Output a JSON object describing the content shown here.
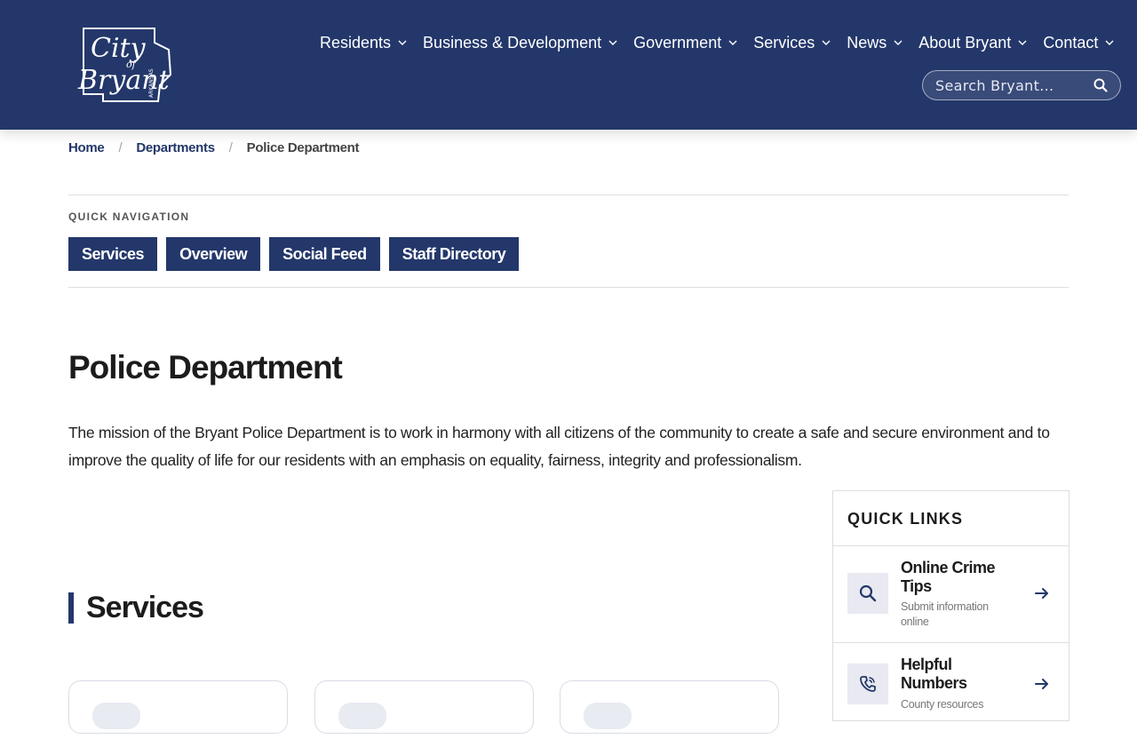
{
  "header": {
    "logo_text": "City of Bryant Arkansas",
    "nav": [
      {
        "label": "Residents"
      },
      {
        "label": "Business & Development"
      },
      {
        "label": "Government"
      },
      {
        "label": "Services"
      },
      {
        "label": "News"
      },
      {
        "label": "About Bryant"
      },
      {
        "label": "Contact"
      }
    ],
    "search_placeholder": "Search Bryant..."
  },
  "breadcrumb": {
    "items": [
      "Home",
      "Departments"
    ],
    "current": "Police Department",
    "separator": "/"
  },
  "quick_nav": {
    "label": "QUICK NAVIGATION",
    "buttons": [
      "Services",
      "Overview",
      "Social Feed",
      "Staff Directory"
    ]
  },
  "main": {
    "title": "Police Department",
    "mission": "The mission of the Bryant Police Department is to work in harmony with all citizens of the community to create a safe and secure environment and to improve the quality of life for our residents with an emphasis on equality, fairness, integrity and professionalism.",
    "services_heading": "Services"
  },
  "quick_links": {
    "title": "QUICK LINKS",
    "items": [
      {
        "name": "Online Crime Tips",
        "desc": "Submit information online",
        "icon": "search-icon"
      },
      {
        "name": "Helpful Numbers",
        "desc": "County resources",
        "icon": "phone-icon"
      }
    ]
  },
  "colors": {
    "brand_navy": "#23376a",
    "icon_bg": "#e8e9f1",
    "rule": "#dedede"
  }
}
